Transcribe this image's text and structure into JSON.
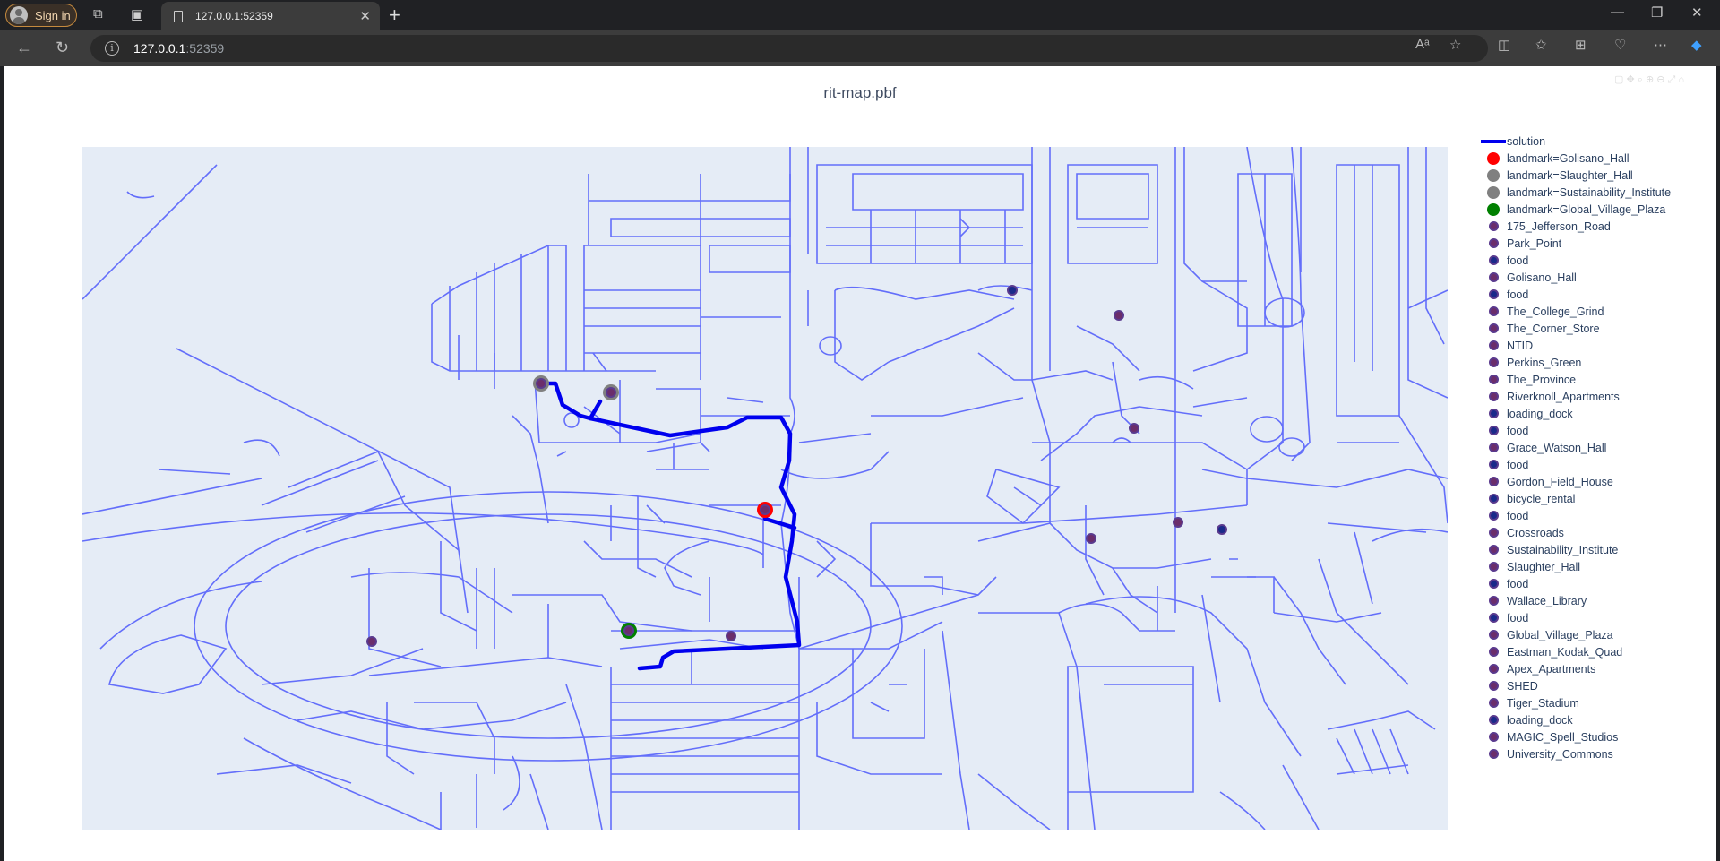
{
  "browser": {
    "sign_in_label": "Sign in",
    "tab_title": "127.0.0.1:52359",
    "url_host": "127.0.0.1",
    "url_port": ":52359"
  },
  "page": {
    "title": "rit-map.pbf"
  },
  "colors": {
    "plot_bg": "#e5ecf6",
    "street": "#636efa",
    "solution": "#0000ee",
    "golisano": "#ff0000",
    "slaughter": "#808080",
    "sustainability": "#808080",
    "global_village": "#008000",
    "poi_fill": "#6b2d6b",
    "food_fill": "#1a2a8a",
    "poi_border": "#5a3a8e"
  },
  "legend": [
    {
      "label": "solution",
      "kind": "line",
      "color": "#0000ee"
    },
    {
      "label": "landmark=Golisano_Hall",
      "kind": "big",
      "color": "#ff0000"
    },
    {
      "label": "landmark=Slaughter_Hall",
      "kind": "big",
      "color": "#808080"
    },
    {
      "label": "landmark=Sustainability_Institute",
      "kind": "big",
      "color": "#808080"
    },
    {
      "label": "landmark=Global_Village_Plaza",
      "kind": "big",
      "color": "#008000"
    },
    {
      "label": "175_Jefferson_Road",
      "kind": "poi",
      "color": "#6b2d6b"
    },
    {
      "label": "Park_Point",
      "kind": "poi",
      "color": "#6b2d6b"
    },
    {
      "label": "food",
      "kind": "poi",
      "color": "#1a2a8a"
    },
    {
      "label": "Golisano_Hall",
      "kind": "poi",
      "color": "#6b2d6b"
    },
    {
      "label": "food",
      "kind": "poi",
      "color": "#1a2a8a"
    },
    {
      "label": "The_College_Grind",
      "kind": "poi",
      "color": "#6b2d6b"
    },
    {
      "label": "The_Corner_Store",
      "kind": "poi",
      "color": "#6b2d6b"
    },
    {
      "label": "NTID",
      "kind": "poi",
      "color": "#6b2d6b"
    },
    {
      "label": "Perkins_Green",
      "kind": "poi",
      "color": "#6b2d6b"
    },
    {
      "label": "The_Province",
      "kind": "poi",
      "color": "#6b2d6b"
    },
    {
      "label": "Riverknoll_Apartments",
      "kind": "poi",
      "color": "#6b2d6b"
    },
    {
      "label": "loading_dock",
      "kind": "poi",
      "color": "#1a2a8a"
    },
    {
      "label": "food",
      "kind": "poi",
      "color": "#1a2a8a"
    },
    {
      "label": "Grace_Watson_Hall",
      "kind": "poi",
      "color": "#6b2d6b"
    },
    {
      "label": "food",
      "kind": "poi",
      "color": "#1a2a8a"
    },
    {
      "label": "Gordon_Field_House",
      "kind": "poi",
      "color": "#6b2d6b"
    },
    {
      "label": "bicycle_rental",
      "kind": "poi",
      "color": "#1a2a8a"
    },
    {
      "label": "food",
      "kind": "poi",
      "color": "#1a2a8a"
    },
    {
      "label": "Crossroads",
      "kind": "poi",
      "color": "#6b2d6b"
    },
    {
      "label": "Sustainability_Institute",
      "kind": "poi",
      "color": "#6b2d6b"
    },
    {
      "label": "Slaughter_Hall",
      "kind": "poi",
      "color": "#6b2d6b"
    },
    {
      "label": "food",
      "kind": "poi",
      "color": "#1a2a8a"
    },
    {
      "label": "Wallace_Library",
      "kind": "poi",
      "color": "#6b2d6b"
    },
    {
      "label": "food",
      "kind": "poi",
      "color": "#1a2a8a"
    },
    {
      "label": "Global_Village_Plaza",
      "kind": "poi",
      "color": "#6b2d6b"
    },
    {
      "label": "Eastman_Kodak_Quad",
      "kind": "poi",
      "color": "#6b2d6b"
    },
    {
      "label": "Apex_Apartments",
      "kind": "poi",
      "color": "#6b2d6b"
    },
    {
      "label": "SHED",
      "kind": "poi",
      "color": "#6b2d6b"
    },
    {
      "label": "Tiger_Stadium",
      "kind": "poi",
      "color": "#6b2d6b"
    },
    {
      "label": "loading_dock",
      "kind": "poi",
      "color": "#1a2a8a"
    },
    {
      "label": "MAGIC_Spell_Studios",
      "kind": "poi",
      "color": "#6b2d6b"
    },
    {
      "label": "University_Commons",
      "kind": "poi",
      "color": "#6b2d6b"
    }
  ]
}
